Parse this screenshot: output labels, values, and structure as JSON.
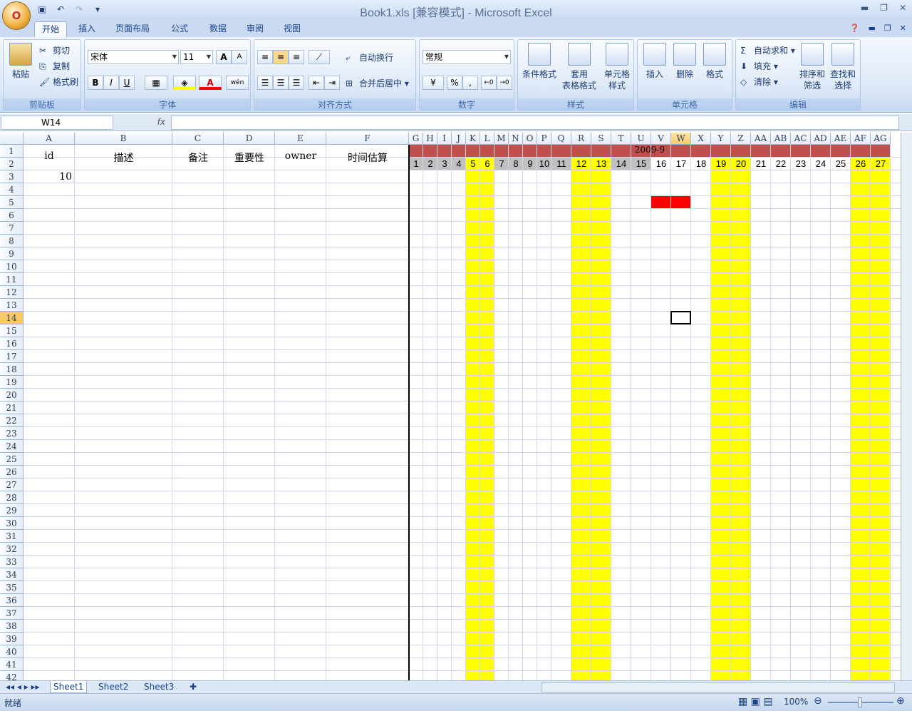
{
  "app": {
    "title": "Book1.xls  [兼容模式] - Microsoft Excel",
    "office_button_glyph": "O",
    "qat_items": [
      "save-icon",
      "undo-icon",
      "redo-icon",
      "customize-icon"
    ]
  },
  "tabs": [
    "开始",
    "插入",
    "页面布局",
    "公式",
    "数据",
    "审阅",
    "视图"
  ],
  "active_tab": "开始",
  "ribbon": {
    "clipboard": {
      "label": "剪贴板",
      "paste": "粘贴",
      "cut": "剪切",
      "copy": "复制",
      "format_painter": "格式刷"
    },
    "font": {
      "label": "字体",
      "font_name": "宋体",
      "font_size": "11",
      "bold": "B",
      "italic": "I",
      "underline": "U",
      "grow": "A",
      "shrink": "A",
      "font_color_glyph": "A",
      "phonetic": "wén"
    },
    "alignment": {
      "label": "对齐方式",
      "wrap": "自动换行",
      "merge": "合并后居中"
    },
    "number": {
      "label": "数字",
      "format": "常规",
      "percent": "%",
      "comma": ","
    },
    "styles": {
      "label": "样式",
      "conditional": "条件格式",
      "table_line1": "套用",
      "table_line2": "表格格式",
      "cell_line1": "单元格",
      "cell_line2": "样式"
    },
    "cells": {
      "label": "单元格",
      "insert": "插入",
      "delete": "删除",
      "format": "格式"
    },
    "editing": {
      "label": "编辑",
      "autosum": "自动求和",
      "fill": "填充",
      "clear": "清除",
      "sort_line1": "排序和",
      "sort_line2": "筛选",
      "find_line1": "查找和",
      "find_line2": "选择"
    }
  },
  "formula_bar": {
    "name_box": "W14",
    "fx": "fx",
    "value": ""
  },
  "columns": [
    "A",
    "B",
    "C",
    "D",
    "E",
    "F",
    "G",
    "H",
    "I",
    "J",
    "K",
    "L",
    "M",
    "N",
    "O",
    "P",
    "Q",
    "R",
    "S",
    "T",
    "U",
    "V",
    "W",
    "X",
    "Y",
    "Z",
    "AA",
    "AB",
    "AC",
    "AD",
    "AE",
    "AF",
    "AG"
  ],
  "selected_column": "W",
  "selected_row": 14,
  "header_row": {
    "A": "id",
    "B": "描述",
    "C": "备注",
    "D": "重要性",
    "E": "owner",
    "F": "时间估算"
  },
  "cell_A3": "10",
  "gantt": {
    "month_label": "2009-9",
    "days": [
      "1",
      "2",
      "3",
      "4",
      "5",
      "6",
      "7",
      "8",
      "9",
      "10",
      "11",
      "12",
      "13",
      "14",
      "15",
      "16",
      "17",
      "18",
      "19",
      "20",
      "21",
      "22",
      "23",
      "24",
      "25",
      "26",
      "27"
    ],
    "weekend_days": [
      "5",
      "6",
      "12",
      "13",
      "19",
      "20",
      "26",
      "27"
    ],
    "gray_days": [
      "1",
      "2",
      "3",
      "4",
      "7",
      "8",
      "9",
      "10",
      "11",
      "14",
      "15"
    ],
    "task_bar_days": [
      "16",
      "17"
    ],
    "task_bar_row": 5
  },
  "colors": {
    "weekend": "#ffff00",
    "month_header": "#c0504d",
    "task": "#ff0000",
    "past_day": "#c0c0c0"
  },
  "sheets": [
    "Sheet1",
    "Sheet2",
    "Sheet3"
  ],
  "active_sheet": "Sheet1",
  "status": {
    "left": "就绪",
    "zoom": "100%"
  }
}
